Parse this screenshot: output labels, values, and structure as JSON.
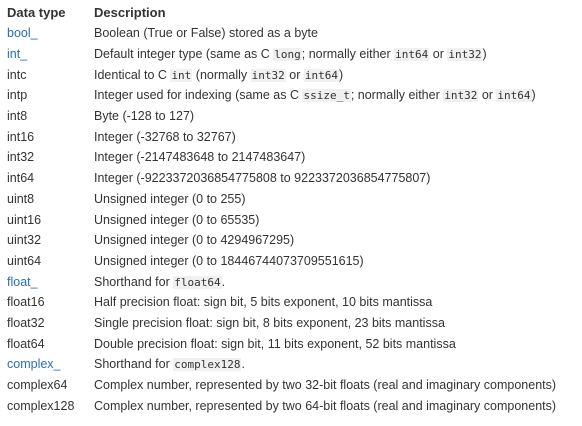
{
  "headers": [
    "Data type",
    "Description"
  ],
  "rows": [
    {
      "type": "bool_",
      "link": true,
      "desc": [
        {
          "t": "Boolean (True or False) stored as a byte"
        }
      ]
    },
    {
      "type": "int_",
      "link": true,
      "desc": [
        {
          "t": "Default integer type (same as C "
        },
        {
          "t": "long",
          "code": true
        },
        {
          "t": "; normally either "
        },
        {
          "t": "int64",
          "code": true
        },
        {
          "t": " or "
        },
        {
          "t": "int32",
          "code": true
        },
        {
          "t": ")"
        }
      ]
    },
    {
      "type": "intc",
      "desc": [
        {
          "t": "Identical to C "
        },
        {
          "t": "int",
          "code": true
        },
        {
          "t": " (normally "
        },
        {
          "t": "int32",
          "code": true
        },
        {
          "t": " or "
        },
        {
          "t": "int64",
          "code": true
        },
        {
          "t": ")"
        }
      ]
    },
    {
      "type": "intp",
      "desc": [
        {
          "t": "Integer used for indexing (same as C "
        },
        {
          "t": "ssize_t",
          "code": true
        },
        {
          "t": "; normally either "
        },
        {
          "t": "int32",
          "code": true
        },
        {
          "t": " or "
        },
        {
          "t": "int64",
          "code": true
        },
        {
          "t": ")"
        }
      ]
    },
    {
      "type": "int8",
      "desc": [
        {
          "t": "Byte (-128 to 127)"
        }
      ]
    },
    {
      "type": "int16",
      "desc": [
        {
          "t": "Integer (-32768 to 32767)"
        }
      ]
    },
    {
      "type": "int32",
      "desc": [
        {
          "t": "Integer (-2147483648 to 2147483647)"
        }
      ]
    },
    {
      "type": "int64",
      "desc": [
        {
          "t": "Integer (-9223372036854775808 to 9223372036854775807)"
        }
      ]
    },
    {
      "type": "uint8",
      "desc": [
        {
          "t": "Unsigned integer (0 to 255)"
        }
      ]
    },
    {
      "type": "uint16",
      "desc": [
        {
          "t": "Unsigned integer (0 to 65535)"
        }
      ]
    },
    {
      "type": "uint32",
      "desc": [
        {
          "t": "Unsigned integer (0 to 4294967295)"
        }
      ]
    },
    {
      "type": "uint64",
      "desc": [
        {
          "t": "Unsigned integer (0 to 18446744073709551615)"
        }
      ]
    },
    {
      "type": "float_",
      "link": true,
      "desc": [
        {
          "t": "Shorthand for "
        },
        {
          "t": "float64",
          "code": true
        },
        {
          "t": "."
        }
      ]
    },
    {
      "type": "float16",
      "desc": [
        {
          "t": "Half precision float: sign bit, 5 bits exponent, 10 bits mantissa"
        }
      ]
    },
    {
      "type": "float32",
      "desc": [
        {
          "t": "Single precision float: sign bit, 8 bits exponent, 23 bits mantissa"
        }
      ]
    },
    {
      "type": "float64",
      "desc": [
        {
          "t": "Double precision float: sign bit, 11 bits exponent, 52 bits mantissa"
        }
      ]
    },
    {
      "type": "complex_",
      "link": true,
      "desc": [
        {
          "t": "Shorthand for "
        },
        {
          "t": "complex128",
          "code": true
        },
        {
          "t": "."
        }
      ]
    },
    {
      "type": "complex64",
      "desc": [
        {
          "t": "Complex number, represented by two 32-bit floats (real and imaginary components)"
        }
      ]
    },
    {
      "type": "complex128",
      "desc": [
        {
          "t": "Complex number, represented by two 64-bit floats (real and imaginary components)"
        }
      ]
    }
  ]
}
